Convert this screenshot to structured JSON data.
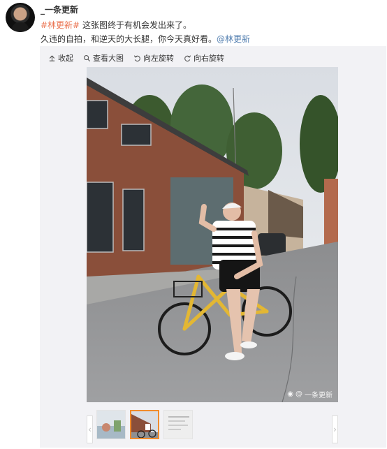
{
  "post": {
    "username": "_一条更新",
    "hashtag": "#林更新#",
    "line1_rest": " 这张图终于有机会发出来了。",
    "line2_text": "久违的自拍，和逆天的大长腿，你今天真好看。",
    "mention": "@林更新"
  },
  "toolbar": {
    "collapse_label": "收起",
    "view_large_label": "查看大图",
    "rotate_left_label": "向左旋转",
    "rotate_right_label": "向右旋转"
  },
  "photo": {
    "watermark_prefix": "@",
    "watermark_name": "一条更新"
  },
  "thumbnails": {
    "selected_index": 1,
    "count": 3,
    "third_thumb_text": "图片来源 微博"
  },
  "colors": {
    "hashtag": "#eb7350",
    "mention": "#507daf",
    "thumb_active_border": "#f28c2b"
  }
}
